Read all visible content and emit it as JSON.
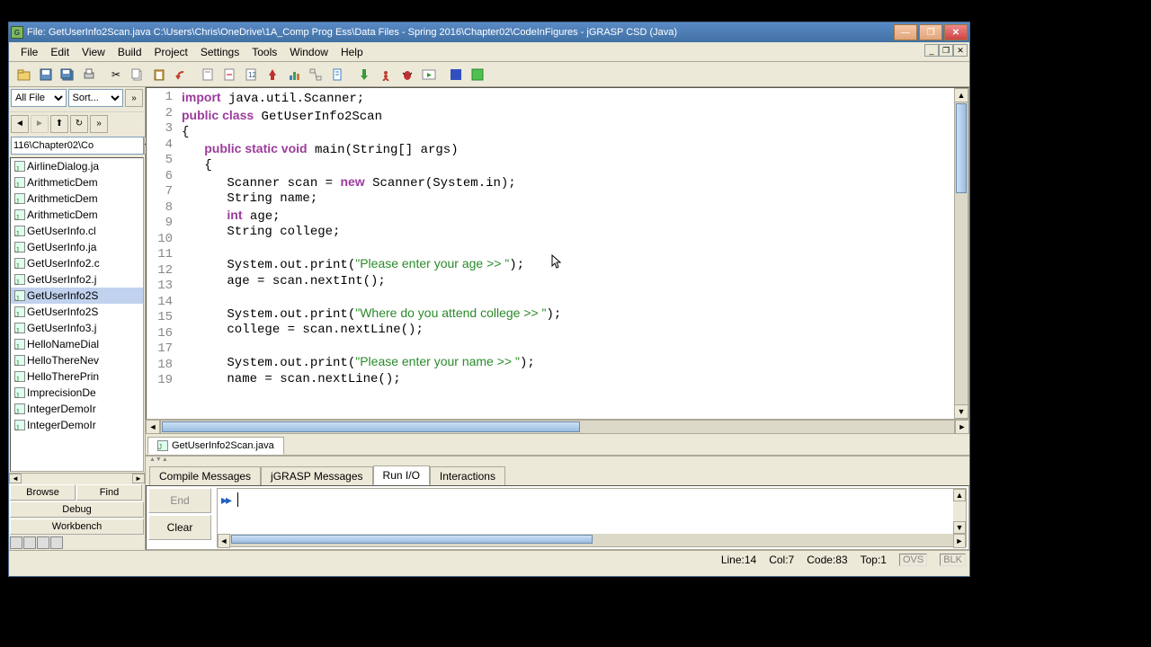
{
  "title": "File: GetUserInfo2Scan.java  C:\\Users\\Chris\\OneDrive\\1A_Comp Prog Ess\\Data Files - Spring 2016\\Chapter02\\CodeInFigures - jGRASP CSD (Java)",
  "menus": [
    "File",
    "Edit",
    "View",
    "Build",
    "Project",
    "Settings",
    "Tools",
    "Window",
    "Help"
  ],
  "sidebar": {
    "filter": "All File",
    "sort": "Sort...",
    "path": "116\\Chapter02\\Co",
    "files": [
      "AirlineDialog.ja",
      "ArithmeticDem",
      "ArithmeticDem",
      "ArithmeticDem",
      "GetUserInfo.cl",
      "GetUserInfo.ja",
      "GetUserInfo2.c",
      "GetUserInfo2.j",
      "GetUserInfo2S",
      "GetUserInfo2S",
      "GetUserInfo3.j",
      "HelloNameDial",
      "HelloThereNev",
      "HelloTherePrin",
      "ImprecisionDe",
      "IntegerDemoIr",
      "IntegerDemoIr"
    ],
    "selected_index": 8,
    "actions": {
      "browse": "Browse",
      "find": "Find",
      "debug": "Debug",
      "workbench": "Workbench"
    }
  },
  "code": {
    "lines": [
      {
        "n": 1,
        "t": [
          [
            "kw",
            "import"
          ],
          [
            "",
            " java.util.Scanner;"
          ]
        ]
      },
      {
        "n": 2,
        "t": [
          [
            "kw",
            "public class"
          ],
          [
            "",
            " GetUserInfo2Scan"
          ]
        ]
      },
      {
        "n": 3,
        "t": [
          [
            "",
            "{"
          ]
        ]
      },
      {
        "n": 4,
        "t": [
          [
            "",
            "   "
          ],
          [
            "kw",
            "public static void"
          ],
          [
            "",
            " main(String[] args)"
          ]
        ]
      },
      {
        "n": 5,
        "t": [
          [
            "",
            "   {"
          ]
        ]
      },
      {
        "n": 6,
        "t": [
          [
            "",
            "      Scanner scan = "
          ],
          [
            "kw",
            "new"
          ],
          [
            "",
            " Scanner(System.in);"
          ]
        ]
      },
      {
        "n": 7,
        "t": [
          [
            "",
            "      String name;"
          ]
        ]
      },
      {
        "n": 8,
        "t": [
          [
            "",
            "      "
          ],
          [
            "kw",
            "int"
          ],
          [
            "",
            " age;"
          ]
        ]
      },
      {
        "n": 9,
        "t": [
          [
            "",
            "      String college;"
          ]
        ]
      },
      {
        "n": 10,
        "t": [
          [
            "",
            ""
          ]
        ]
      },
      {
        "n": 11,
        "t": [
          [
            "",
            "      System.out.print("
          ],
          [
            "str",
            "\"Please enter your age >> \""
          ],
          [
            "",
            ");"
          ]
        ]
      },
      {
        "n": 12,
        "t": [
          [
            "",
            "      age = scan.nextInt();"
          ]
        ]
      },
      {
        "n": 13,
        "t": [
          [
            "",
            ""
          ]
        ]
      },
      {
        "n": 14,
        "t": [
          [
            "",
            "      System.out.print("
          ],
          [
            "str",
            "\"Where do you attend college >> \""
          ],
          [
            "",
            ");"
          ]
        ]
      },
      {
        "n": 15,
        "t": [
          [
            "",
            "      college = scan.nextLine();"
          ]
        ]
      },
      {
        "n": 16,
        "t": [
          [
            "",
            ""
          ]
        ]
      },
      {
        "n": 17,
        "t": [
          [
            "",
            "      System.out.print("
          ],
          [
            "str",
            "\"Please enter your name >> \""
          ],
          [
            "",
            ");"
          ]
        ]
      },
      {
        "n": 18,
        "t": [
          [
            "",
            "      name = scan.nextLine();"
          ]
        ]
      },
      {
        "n": 19,
        "t": [
          [
            "",
            ""
          ]
        ]
      }
    ]
  },
  "file_tab": "GetUserInfo2Scan.java",
  "bottom_tabs": [
    "Compile Messages",
    "jGRASP Messages",
    "Run I/O",
    "Interactions"
  ],
  "bottom_active": 2,
  "io": {
    "end": "End",
    "clear": "Clear",
    "prompt": "▸▸"
  },
  "status": {
    "line": "Line:14",
    "col": "Col:7",
    "code": "Code:83",
    "top": "Top:1",
    "ovs": "OVS",
    "blk": "BLK"
  }
}
